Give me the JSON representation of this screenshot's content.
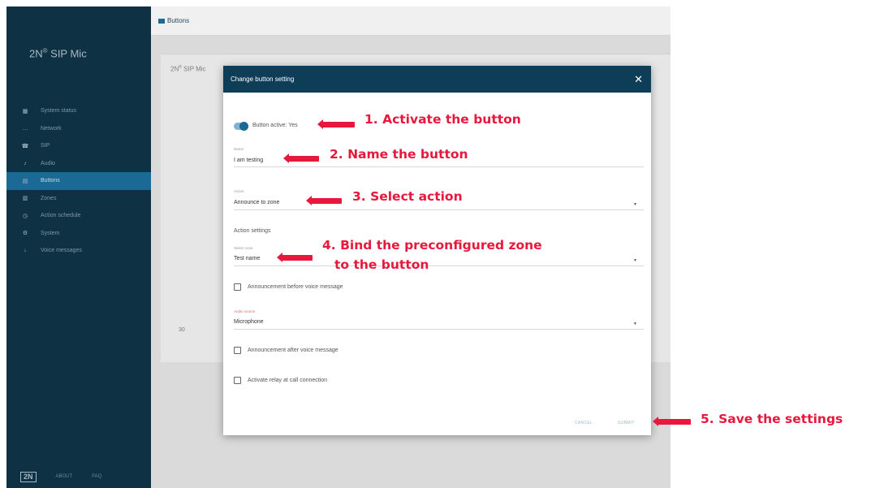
{
  "app": {
    "brand_main": "2N",
    "brand_sup": "®",
    "brand_rest": " SIP Mic"
  },
  "sidebar": {
    "items": [
      {
        "icon": "dashboard-icon",
        "glyph": "▦",
        "label": "System status",
        "active": false
      },
      {
        "icon": "network-icon",
        "glyph": "…",
        "label": "Network",
        "active": false
      },
      {
        "icon": "phone-icon",
        "glyph": "☎",
        "label": "SIP",
        "active": false
      },
      {
        "icon": "music-icon",
        "glyph": "♪",
        "label": "Audio",
        "active": false
      },
      {
        "icon": "buttons-icon",
        "glyph": "▤",
        "label": "Buttons",
        "active": true
      },
      {
        "icon": "zones-icon",
        "glyph": "▥",
        "label": "Zones",
        "active": false
      },
      {
        "icon": "clock-icon",
        "glyph": "◷",
        "label": "Action schedule",
        "active": false
      },
      {
        "icon": "gear-icon",
        "glyph": "⚙",
        "label": "System",
        "active": false
      },
      {
        "icon": "voice-icon",
        "glyph": "↓",
        "label": "Voice messages",
        "active": false
      }
    ],
    "footer_links": [
      "ABOUT",
      "FAQ"
    ]
  },
  "topbar": {
    "title": "Buttons"
  },
  "background_card": {
    "title_main": "2N",
    "title_sup": "®",
    "title_rest": " SIP Mic",
    "row_number": "30"
  },
  "dialog": {
    "title": "Change button setting",
    "close_glyph": "✕",
    "toggle_label": "Button active: Yes",
    "name_label": "Name",
    "name_value": "I am testing",
    "action_label": "Action",
    "action_value": "Announce to zone",
    "section_title": "Action settings",
    "zone_label": "Select zone",
    "zone_value": "Test name",
    "check_before": "Announcement before voice message",
    "audio_label": "Audio source",
    "audio_value": "Microphone",
    "check_after": "Announcement after voice message",
    "check_relay": "Activate relay at call connection",
    "cancel_label": "CANCEL",
    "submit_label": "SUBMIT",
    "caret_glyph": "▼"
  },
  "annotations": {
    "step1": "1. Activate the button",
    "step2": "2. Name the button",
    "step3": "3. Select action",
    "step4_line1": "4. Bind the preconfigured zone",
    "step4_line2": "to the button",
    "step5": "5. Save the settings"
  },
  "colors": {
    "sidebar": "#0e3244",
    "active_nav": "#1b6a96",
    "dialog_header": "#0e3d57",
    "annotation": "#e8183d"
  }
}
